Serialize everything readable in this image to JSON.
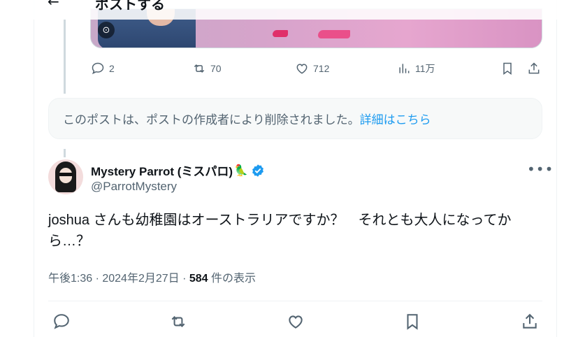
{
  "header": {
    "title": "ポストする",
    "back_glyph": "←"
  },
  "media": {
    "badge_icon": "alt-text-icon"
  },
  "prev_post_actions": {
    "reply": {
      "icon": "reply-icon",
      "count": "2"
    },
    "repost": {
      "icon": "repost-icon",
      "count": "70"
    },
    "like": {
      "icon": "heart-icon",
      "count": "712"
    },
    "views": {
      "icon": "views-icon",
      "count": "11万"
    },
    "bookmark": {
      "icon": "bookmark-icon"
    },
    "share": {
      "icon": "share-icon"
    }
  },
  "notice": {
    "text": "このポストは、ポストの作成者により削除されました。",
    "link": "詳細はこちら"
  },
  "post": {
    "display_name": "Mystery Parrot (ミスパロ)",
    "name_emoji": "🦜",
    "handle": "@ParrotMystery",
    "more_label": "•••",
    "text": "joshua さんも幼稚園はオーストラリアですか？　それとも大人になってから…？",
    "time": "午後1:36 · 2024年2月27日 · ",
    "views_count": "584",
    "views_label": " 件の表示"
  },
  "colors": {
    "accent": "#1d9bf0",
    "muted": "#536471",
    "text": "#0f1419"
  }
}
